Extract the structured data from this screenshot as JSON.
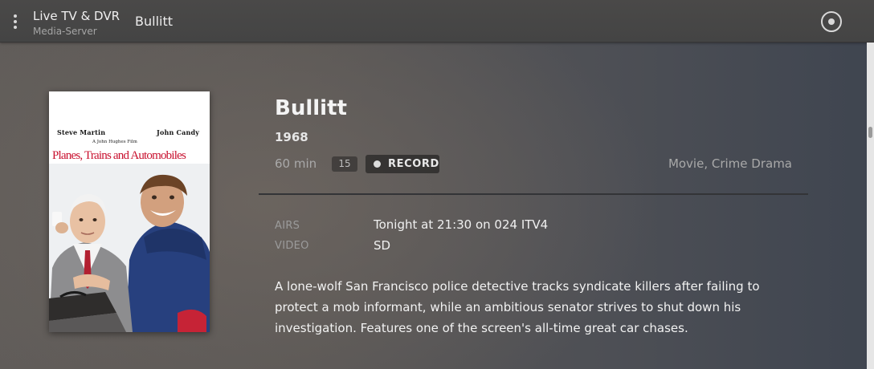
{
  "header": {
    "section_title": "Live TV & DVR",
    "server_name": "Media-Server",
    "crumb_title": "Bullitt",
    "menu_icon": "more-vertical-icon",
    "record_status_icon": "record-circle-icon"
  },
  "poster": {
    "actor_left": "Steve Martin",
    "actor_right": "John Candy",
    "tagline": "A John Hughes Film",
    "title": "Planes, Trains and Automobiles"
  },
  "details": {
    "title": "Bullitt",
    "year": "1968",
    "duration": "60 min",
    "rating": "15",
    "record_label": "RECORD",
    "genres": "Movie, Crime Drama"
  },
  "meta": {
    "airs_label": "AIRS",
    "airs_value": "Tonight at 21:30 on 024 ITV4",
    "video_label": "VIDEO",
    "video_value": "SD"
  },
  "summary": "A lone-wolf San Francisco police detective tracks syndicate killers after failing to protect a mob informant, while an ambitious senator strives to shut down his investigation. Features one of the screen's all-time great car chases.",
  "colors": {
    "poster_title": "#c8102e",
    "background_left": "#605c59",
    "background_right": "#3f4550"
  }
}
